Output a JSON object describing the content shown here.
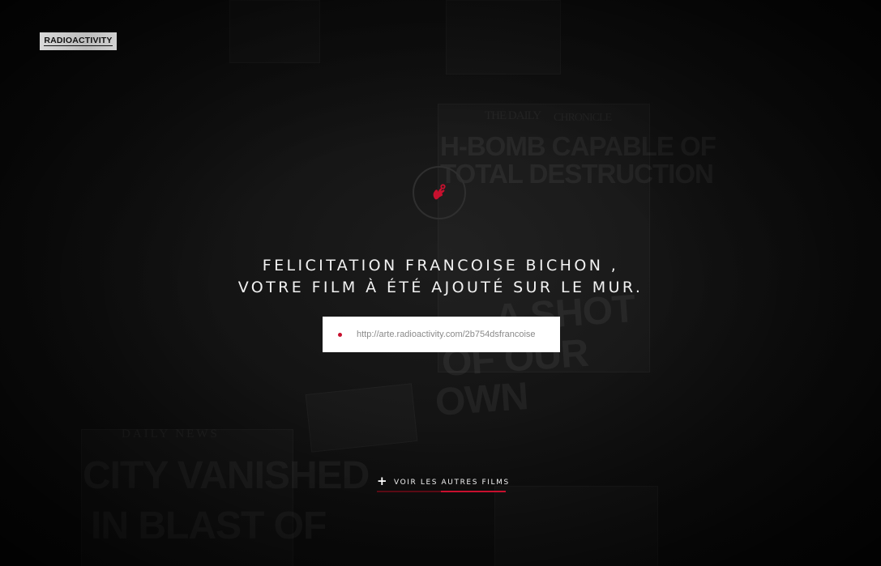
{
  "brand": {
    "logo_text": "RADIOACTIVITY"
  },
  "background": {
    "headlines": [
      "H-BOMB CAPABLE OF",
      "TOTAL DESTRUCTION",
      "CITY VANISHED",
      "IN BLAST OF",
      "A SHOT",
      "OF OUR",
      "OWN",
      "The Daily",
      "Chronicle",
      "DAILY NEWS"
    ]
  },
  "badge": {
    "icon": "hand-ok-icon"
  },
  "confirmation": {
    "line1": "FELICITATION FRANCOISE BICHON ,",
    "line2": "VOTRE FILM À ÉTÉ AJOUTÉ SUR LE MUR."
  },
  "share": {
    "url": "http://arte.radioactivity.com/2b754dsfrancoise"
  },
  "cta": {
    "plus": "+",
    "label": "VOIR LES AUTRES FILMS"
  },
  "colors": {
    "accent": "#c8102e",
    "background": "#111111",
    "text": "#f2f2f2"
  }
}
